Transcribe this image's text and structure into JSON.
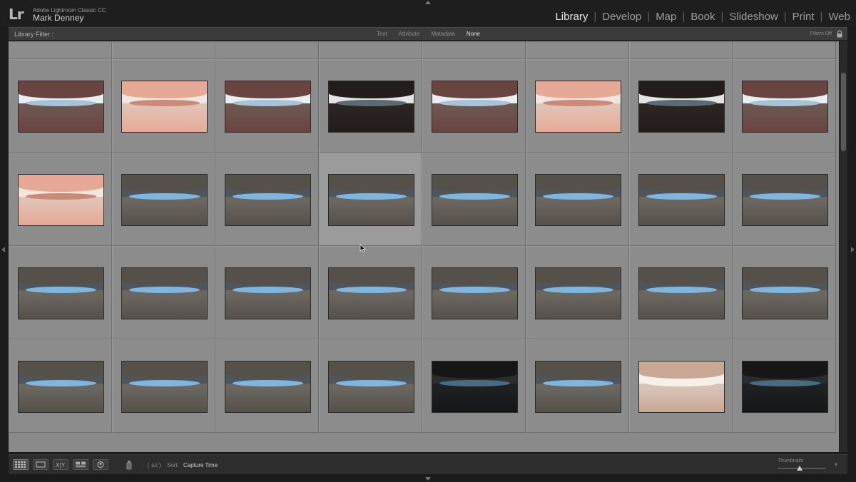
{
  "app": {
    "logo": "Lr",
    "product": "Adobe Lightroom Classic CC",
    "user": "Mark Denney"
  },
  "modules": [
    {
      "label": "Library",
      "active": true
    },
    {
      "label": "Develop",
      "active": false
    },
    {
      "label": "Map",
      "active": false
    },
    {
      "label": "Book",
      "active": false
    },
    {
      "label": "Slideshow",
      "active": false
    },
    {
      "label": "Print",
      "active": false
    },
    {
      "label": "Web",
      "active": false
    }
  ],
  "module_separator": "|",
  "filter": {
    "label": "Library Filter :",
    "options": [
      {
        "label": "Text",
        "selected": false
      },
      {
        "label": "Attribute",
        "selected": false
      },
      {
        "label": "Metadata",
        "selected": false
      },
      {
        "label": "None",
        "selected": true
      }
    ],
    "status": "Filters Off"
  },
  "toolbar": {
    "sort_label": "Sort:",
    "sort_value": "Capture Time",
    "thumbnails_label": "Thumbnails",
    "thumbnail_size": 0.45
  },
  "palette": {
    "warm_light": [
      "#f2e6de",
      "#e6a996",
      "#c98a7a",
      "#e2c2b6"
    ],
    "warm": [
      "#e8eef2",
      "#6a4440",
      "#a7c3d8",
      "#6d5650"
    ],
    "cool": [
      "#4f555a",
      "#55504a",
      "#7fb6e0",
      "#6a6660"
    ],
    "dark": [
      "#e4e4e4",
      "#221c1a",
      "#5c6a72",
      "#2a2422"
    ],
    "night": [
      "#2a2d30",
      "#161616",
      "#4a6c82",
      "#1d2022"
    ],
    "bright": [
      "#f4efeb",
      "#caa896",
      "#f8f0e8",
      "#d8c2b8"
    ]
  },
  "grid_rows": [
    [
      "warm",
      "warm",
      "warm",
      "night",
      "warm",
      "warm_light",
      "warm",
      "night"
    ],
    [
      "warm",
      "warm_light",
      "warm",
      "dark",
      "warm",
      "warm_light",
      "dark",
      "warm"
    ],
    [
      "warm_light",
      "cool",
      "cool",
      "cool",
      "cool",
      "cool",
      "cool",
      "cool"
    ],
    [
      "cool",
      "cool",
      "cool",
      "cool",
      "cool",
      "cool",
      "cool",
      "cool"
    ],
    [
      "cool",
      "cool",
      "cool",
      "cool",
      "night",
      "cool",
      "bright",
      "night"
    ]
  ],
  "badged_cell": {
    "row": 0,
    "col": 6
  },
  "hover_cell": {
    "row": 2,
    "col": 3
  }
}
